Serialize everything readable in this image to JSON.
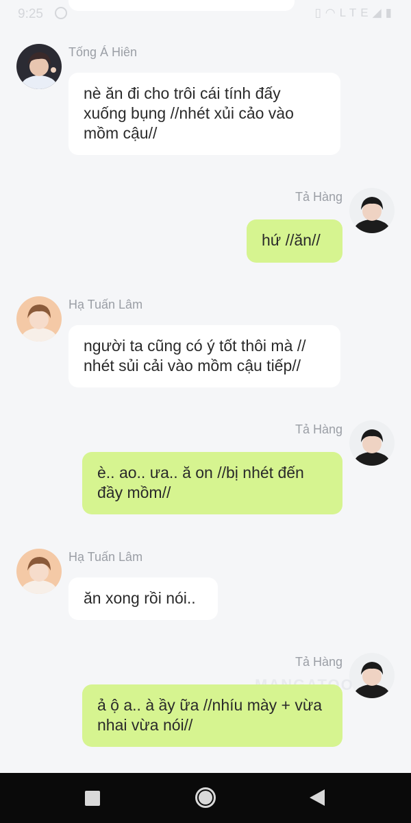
{
  "status_bar": {
    "time": "9:25",
    "network": "LTE"
  },
  "watermark": "MANGATOO",
  "messages": [
    {
      "sender": "Tống Á Hiên",
      "side": "left",
      "avatar": "avatar-tong-a-hien",
      "text": "nè ăn đi cho trôi cái tính đấy xuống bụng //nhét xủi cảo vào mồm cậu//"
    },
    {
      "sender": "Tả Hàng",
      "side": "right",
      "avatar": "avatar-ta-hang",
      "text": "hứ //ăn//"
    },
    {
      "sender": "Hạ Tuấn Lâm",
      "side": "left",
      "avatar": "avatar-ha-tuan-lam",
      "text": "người ta cũng có ý tốt thôi mà // nhét sủi cải vào mồm cậu tiếp//"
    },
    {
      "sender": "Tả Hàng",
      "side": "right",
      "avatar": "avatar-ta-hang",
      "text": "è.. ao.. ưa.. ă on //bị nhét đến đầy mồm//"
    },
    {
      "sender": "Hạ Tuấn Lâm",
      "side": "left",
      "avatar": "avatar-ha-tuan-lam",
      "text": "ăn xong rồi nói.."
    },
    {
      "sender": "Tả Hàng",
      "side": "right",
      "avatar": "avatar-ta-hang",
      "text": "ả ộ a.. à ầy ữa //nhíu mày + vừa nhai vừa nói//"
    }
  ],
  "nav_bar": {
    "recents": "recents-icon",
    "home": "home-icon",
    "back": "back-icon"
  }
}
